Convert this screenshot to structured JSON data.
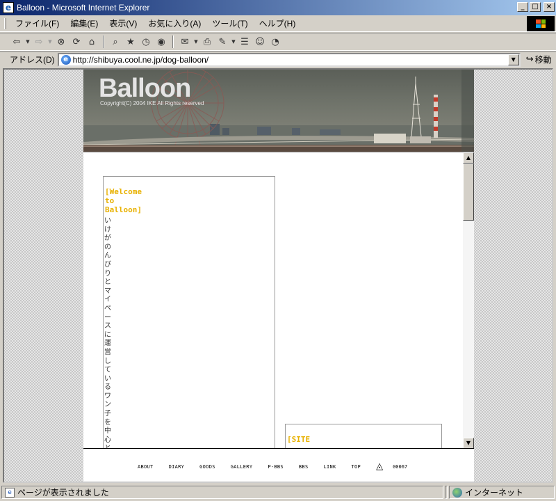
{
  "window": {
    "title": "Balloon - Microsoft Internet Explorer",
    "buttons": {
      "minimize": "_",
      "maximize": "□",
      "close": "×"
    }
  },
  "menubar": {
    "items": [
      "ファイル(F)",
      "編集(E)",
      "表示(V)",
      "お気に入り(A)",
      "ツール(T)",
      "ヘルプ(H)"
    ]
  },
  "toolbar": {
    "icons": [
      "back-icon",
      "forward-icon",
      "stop-icon",
      "refresh-icon",
      "home-icon",
      "search-icon",
      "favorites-icon",
      "history-icon",
      "media-icon",
      "mail-icon",
      "print-icon",
      "edit-icon",
      "discuss-icon",
      "messenger-icon"
    ]
  },
  "addressbar": {
    "label": "アドレス(D)",
    "url": "http://shibuya.cool.ne.jp/dog-balloon/",
    "go_label": "移動"
  },
  "page": {
    "header": {
      "title": "Balloon",
      "copyright": "Copyright(C) 2004 IKE All Rights reserved"
    },
    "welcome": {
      "heading_lines": [
        "[Welcome",
        "to",
        "Balloon]"
      ],
      "text": "いけがのんびりとマイペースに運営しているワン子を中心とした趣"
    },
    "site_box": {
      "heading": "[SITE"
    },
    "nav": {
      "links": [
        "ABOUT",
        "DIARY",
        "GOODS",
        "GALLERY",
        "P-BBS",
        "BBS",
        "LINK",
        "TOP"
      ],
      "counter": "00067"
    }
  },
  "statusbar": {
    "message": "ページが表示されました",
    "zone": "インターネット"
  },
  "colors": {
    "title_gradient_start": "#0a246a",
    "title_gradient_end": "#a6caf0",
    "heading_accent": "#e8b100",
    "chrome": "#d4d0c8"
  }
}
